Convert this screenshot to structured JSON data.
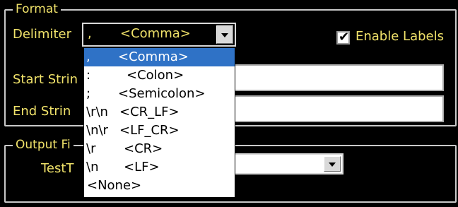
{
  "format_group": {
    "title": "Format"
  },
  "delimiter": {
    "label": "Delimiter",
    "code": ",",
    "name": "<Comma>"
  },
  "enable_labels": {
    "label": "Enable Labels",
    "checked": true
  },
  "start_string": {
    "label": "Start Strin"
  },
  "end_string": {
    "label": "End Strin"
  },
  "output_group": {
    "title": "Output Fi"
  },
  "test_label": "TestT",
  "delimiter_options": [
    {
      "code": ",",
      "name": "<Comma>",
      "selected": true
    },
    {
      "code": ":",
      "name": "<Colon>"
    },
    {
      "code": ";",
      "name": "<Semicolon>"
    },
    {
      "code": "\\r\\n",
      "name": "<CR_LF>"
    },
    {
      "code": "\\n\\r",
      "name": "<LF_CR>"
    },
    {
      "code": "\\r",
      "name": "<CR>"
    },
    {
      "code": "\\n",
      "name": "<LF>"
    },
    {
      "code": "",
      "name": "<None>"
    }
  ],
  "colors": {
    "label_text": "#f0e26a",
    "background": "#000000",
    "selection": "#2f72c6"
  }
}
